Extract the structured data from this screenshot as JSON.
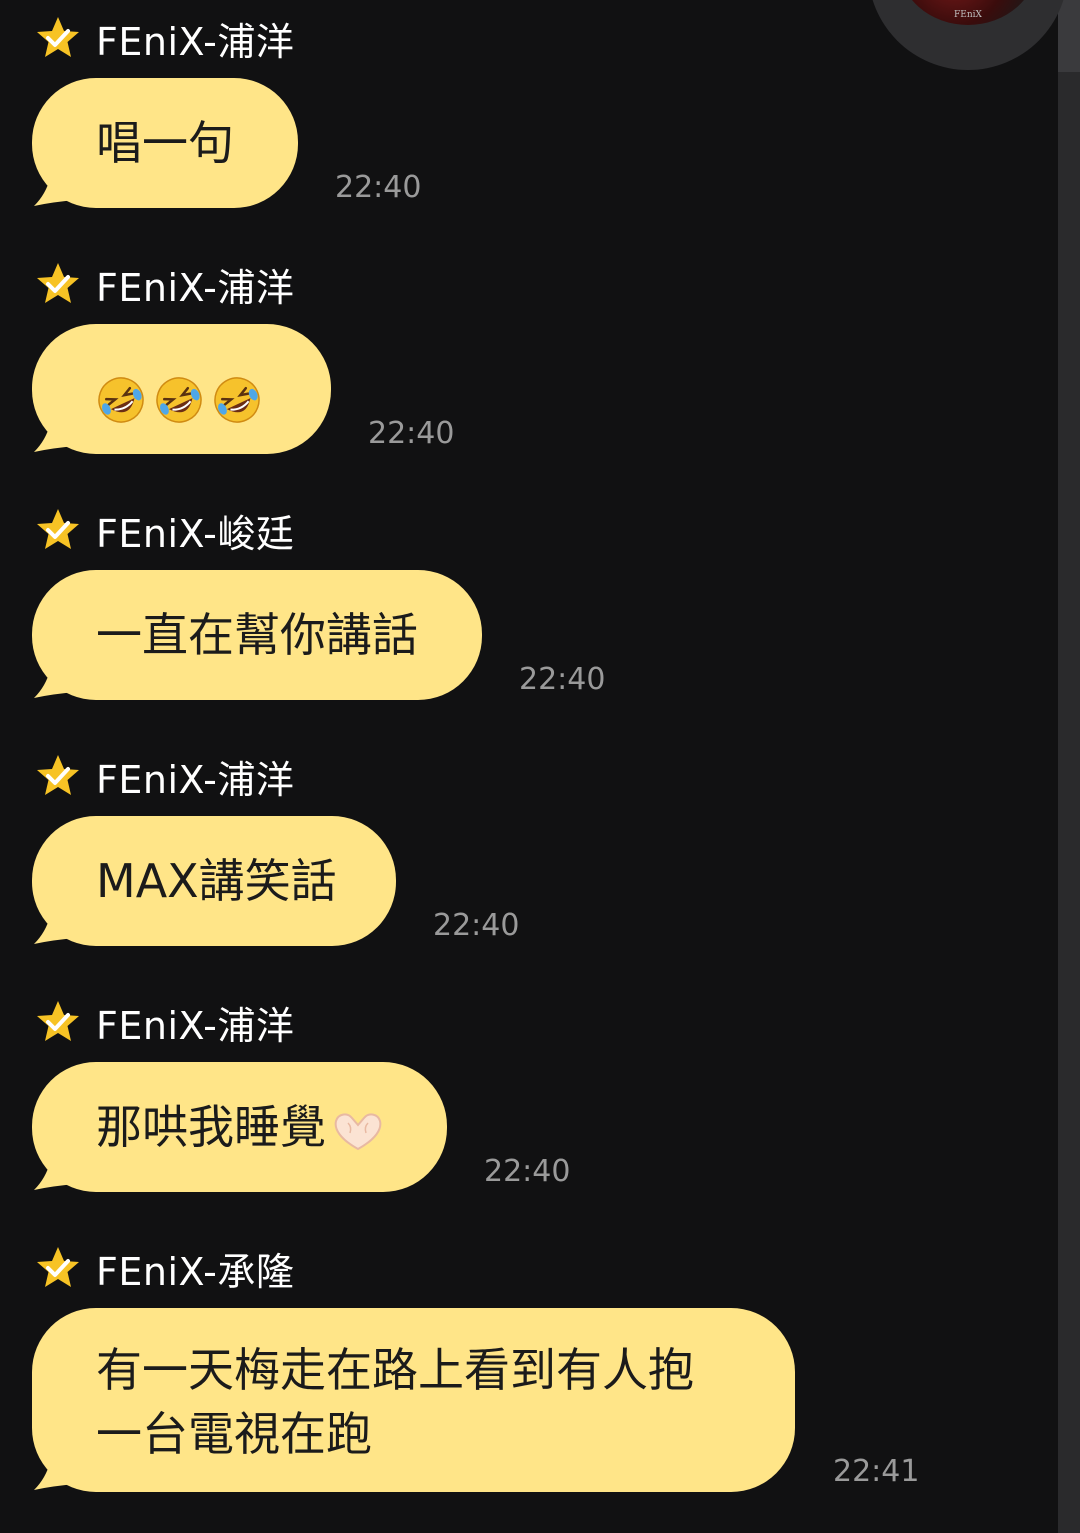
{
  "messages": [
    {
      "sender": "FEniX-浦洋",
      "text": "唱一句",
      "time": "22:40"
    },
    {
      "sender": "FEniX-浦洋",
      "emoji": [
        "rolling-on-floor-laughing",
        "rolling-on-floor-laughing",
        "rolling-on-floor-laughing"
      ],
      "time": "22:40"
    },
    {
      "sender": "FEniX-峻廷",
      "text": "一直在幫你講話",
      "time": "22:40"
    },
    {
      "sender": "FEniX-浦洋",
      "text": "MAX講笑話",
      "time": "22:40"
    },
    {
      "sender": "FEniX-浦洋",
      "text": "那哄我睡覺",
      "trailing_emoji": "heart-hands",
      "time": "22:40"
    },
    {
      "sender": "FEniX-承隆",
      "lines": [
        "有一天梅走在路上看到有人抱",
        "一台電視在跑"
      ],
      "time": "22:41"
    }
  ],
  "avatar": {
    "mark": "FEniX"
  },
  "colors": {
    "background": "#111112",
    "bubble": "#ffe588",
    "star": "#f7c325",
    "timestamp": "#9a9a9a",
    "sender_text": "#ffffff"
  }
}
